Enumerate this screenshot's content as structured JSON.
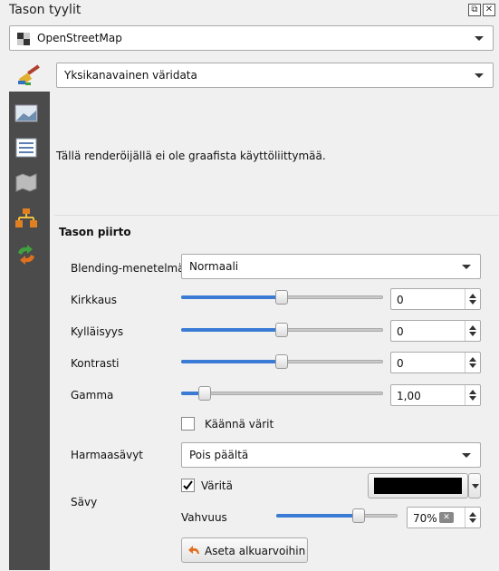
{
  "window": {
    "title": "Tason tyylit"
  },
  "layer_combo": {
    "value": "OpenStreetMap"
  },
  "renderer_combo": {
    "value": "Yksikanavainen väridata"
  },
  "info_text": "Tällä renderöijällä ei ole graafista käyttöliittymää.",
  "layer_rendering": {
    "heading": "Tason piirto",
    "blending": {
      "label": "Blending-menetelmä",
      "value": "Normaali"
    },
    "brightness": {
      "label": "Kirkkaus",
      "value": "0",
      "slider_fraction": 0.5
    },
    "saturation": {
      "label": "Kylläisyys",
      "value": "0",
      "slider_fraction": 0.5
    },
    "contrast": {
      "label": "Kontrasti",
      "value": "0",
      "slider_fraction": 0.5
    },
    "gamma": {
      "label": "Gamma",
      "value": "1,00",
      "slider_fraction": 0.1
    },
    "invert": {
      "label": "Käännä värit",
      "checked": false
    },
    "grayscale": {
      "label": "Harmaasävyt",
      "value": "Pois päältä"
    },
    "hue": {
      "label": "Sävy",
      "colorize": {
        "label": "Väritä",
        "checked": true
      },
      "color": "#000000",
      "strength": {
        "label": "Vahvuus",
        "value": "70%",
        "slider_fraction": 0.7
      }
    },
    "reset_button": "Aseta alkuarvoihin"
  },
  "colors": {
    "slider_fill": "#3a7bd5",
    "sidebar": "#4b4b4b"
  }
}
